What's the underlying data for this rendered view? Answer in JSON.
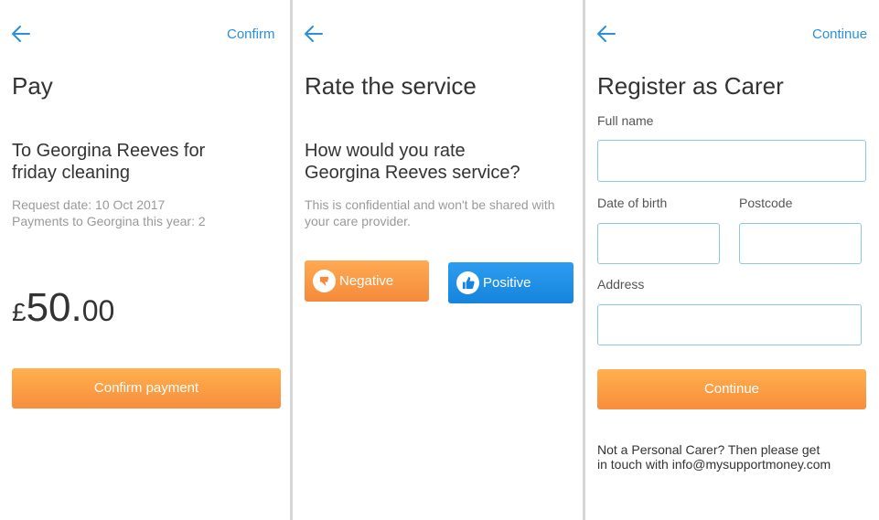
{
  "pay": {
    "confirm_label": "Confirm",
    "title": "Pay",
    "subtitle_line1": "To Georgina Reeves for",
    "subtitle_line2": "friday cleaning",
    "request_date": "Request date: 10 Oct 2017",
    "payments_count": "Payments to Georgina this year: 2",
    "amount_currency": "£",
    "amount_main": "50.",
    "amount_decimal": "00",
    "confirm_payment_label": "Confirm payment"
  },
  "rate": {
    "title": "Rate the service",
    "question_line1": "How would you rate",
    "question_line2": "Georgina Reeves service?",
    "note_line1": "This is confidential and won't be shared with",
    "note_line2": "your care provider.",
    "negative_label": "Negative",
    "positive_label": "Positive"
  },
  "register": {
    "continue_top_label": "Continue",
    "title": "Register as Carer",
    "full_name_label": "Full name",
    "dob_label": "Date of birth",
    "postcode_label": "Postcode",
    "address_label": "Address",
    "continue_label": "Continue",
    "footer_line1": "Not a Personal Carer? Then please get",
    "footer_line2": "in touch with info@mysupportmoney.com"
  },
  "colors": {
    "accent_blue": "#2a8fe0",
    "orange": "#f88d3d",
    "muted_text": "#9a9a9a"
  },
  "icons": [
    "back-arrow-icon",
    "thumbs-down-icon",
    "thumbs-up-icon"
  ]
}
